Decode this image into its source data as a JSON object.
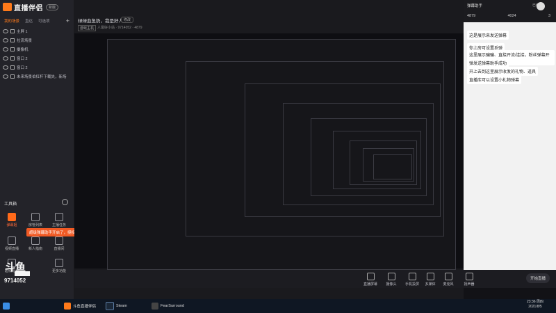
{
  "app": {
    "logo_text": "直播伴侣",
    "badge": "新版"
  },
  "sidebar": {
    "tabs": [
      "我的场景",
      "直达",
      "可选项"
    ],
    "add_icon": "plus-icon",
    "sources": [
      "主屏 1",
      "拉流场景",
      "摄像机",
      "窗口 2",
      "窗口 2",
      "未来场景伯杠杆下载失，新场"
    ],
    "toolbox_title": "工具箱",
    "tools": [
      {
        "label": "弹幕姬",
        "highlight": true
      },
      {
        "label": "房管列表"
      },
      {
        "label": "主播任务"
      },
      {
        "label": "视频直播"
      },
      {
        "label": "新人指南"
      },
      {
        "label": "直播间"
      },
      {
        "label": "超级粉丝"
      },
      {
        "label": "更多功能"
      }
    ],
    "toast": "超级弹幕助手开启了，授权成功吗~ ×",
    "room_number": "9714052"
  },
  "header": {
    "live_title": "绿绿血鱼奶，我是好人",
    "edit_label": "修改",
    "category": "游戏主机",
    "room_info": "人最好小站 · 9714052 · 4879"
  },
  "bottom_toolbar": {
    "items": [
      "直播屏幕",
      "摄像头",
      "手机投屏",
      "多媒体",
      "麦克风",
      "扬声器"
    ],
    "live_label": "开始直播"
  },
  "right_panel": {
    "user": "弹幕助手",
    "status": "已绑定",
    "stats": [
      "4879",
      "4024",
      "3"
    ],
    "messages": [
      "这是展示来发送弹幕",
      "你上房可设置系弹",
      "这里展示骗骗、直接开流/连接，粉丝弹幕开弹等",
      "弹发送弹幕助手成功",
      "开上去到这里展示收发的礼物、道具",
      "直播库可以设置小礼物弹幕"
    ]
  },
  "taskbar": {
    "items": [
      "斗鱼直播伴侣",
      "Steam",
      "FearSurround"
    ],
    "time": "23:36 周四",
    "date": "2021/8/5"
  }
}
